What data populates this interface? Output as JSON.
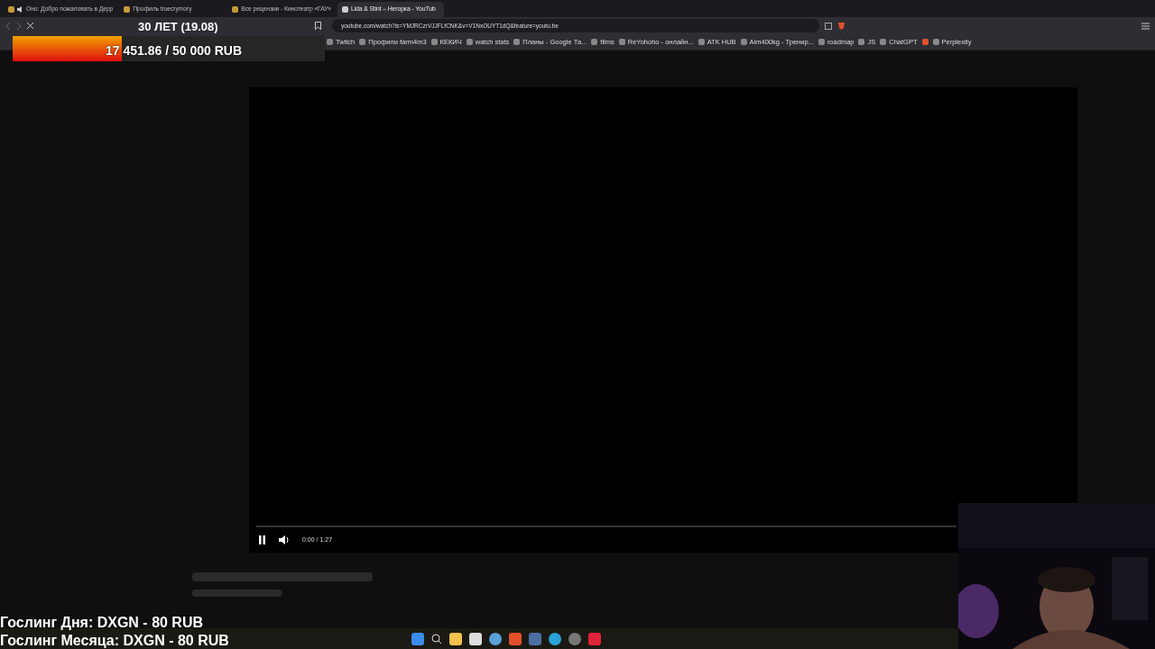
{
  "browser": {
    "tabs": [
      {
        "title": "Оно: Добро пожаловать в Дерр",
        "audio": true,
        "selected": false
      },
      {
        "title": "Профиль truecrymory",
        "audio": false,
        "selected": false
      },
      {
        "title": "Все рецензии - Кинотеатр «ГАУ»",
        "audio": false,
        "selected": false
      },
      {
        "title": "Lida & Stint – Негорка - YouTub",
        "audio": false,
        "selected": true
      }
    ],
    "address": "youtube.com/watch?is=YMJRCzrVJJFLfCNK&v=V1NxOUYT1dQ&feature=youtu.be",
    "bookmarks": [
      {
        "kind": "link",
        "label": "Twitch"
      },
      {
        "kind": "link",
        "label": "Профили farm4m3"
      },
      {
        "kind": "link",
        "label": "КЕКИЧ"
      },
      {
        "kind": "link",
        "label": "watch stats"
      },
      {
        "kind": "link",
        "label": "Планы - Google Та..."
      },
      {
        "kind": "link",
        "label": "films"
      },
      {
        "kind": "link",
        "label": "ReYohoho - онлайн..."
      },
      {
        "kind": "link",
        "label": "ATK HUB"
      },
      {
        "kind": "link",
        "label": "Aim400kg - Тренир..."
      },
      {
        "kind": "link",
        "label": "roadmap"
      },
      {
        "kind": "link",
        "label": "JS"
      },
      {
        "kind": "link",
        "label": "ChatGPT"
      },
      {
        "kind": "icon"
      },
      {
        "kind": "link",
        "label": "Perplexity"
      }
    ]
  },
  "player": {
    "playing": true,
    "time": "0:00 / 1:27"
  },
  "overlay": {
    "goal_title": "30 ЛЕТ (19.08)",
    "goal_text": "17 451.86 / 50 000 RUB",
    "level": 0.35,
    "donors": [
      "Гослинг Дня: DXGN - 80 RUB",
      "Гослинг Месяца: DXGN - 80 RUB"
    ]
  }
}
